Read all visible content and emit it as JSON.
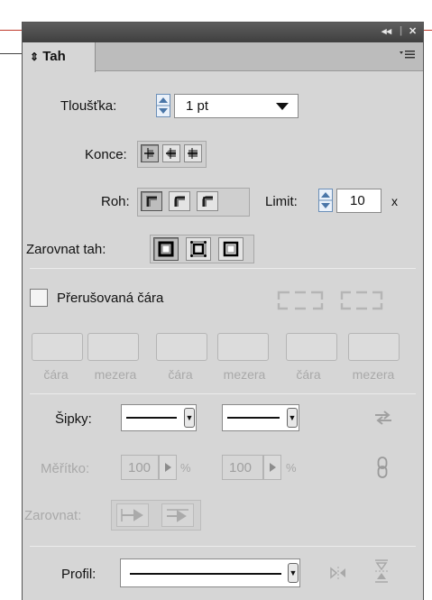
{
  "panel": {
    "tab_label": "Tah",
    "tab_arrow": "⇕",
    "menu_icon": "menu-lines-icon",
    "title_controls": {
      "collapse": "◂◂",
      "close": "✕"
    }
  },
  "weight": {
    "label": "Tloušťka:",
    "value": "1 pt"
  },
  "cap": {
    "label": "Konce:"
  },
  "join": {
    "label": "Roh:",
    "limit_label": "Limit:",
    "limit_value": "10",
    "limit_unit": "x"
  },
  "align": {
    "label": "Zarovnat tah:"
  },
  "dashed": {
    "checkbox_label": "Přerušovaná čára",
    "checked": false,
    "fields": [
      "čára",
      "mezera",
      "čára",
      "mezera",
      "čára",
      "mezera"
    ]
  },
  "arrowheads": {
    "label": "Šipky:"
  },
  "scale": {
    "label": "Měřítko:",
    "start_value": "100",
    "end_value": "100",
    "unit": "%"
  },
  "arrow_align": {
    "label": "Zarovnat:"
  },
  "profile": {
    "label": "Profil:"
  },
  "colors": {
    "panel_bg": "#d6d6d6",
    "titlebar": "#4a4a4a",
    "stepper_blue": "#6b8fb8"
  }
}
